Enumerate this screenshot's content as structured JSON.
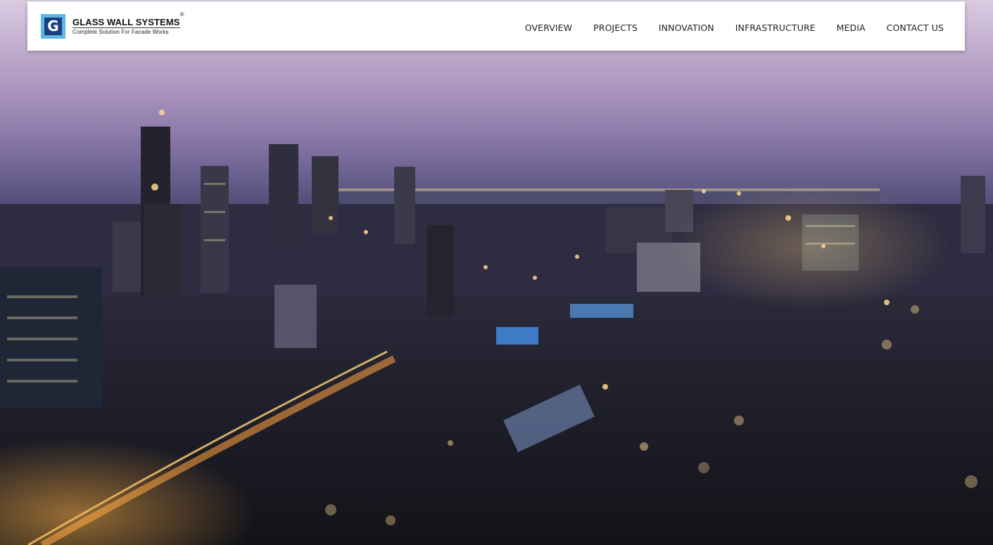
{
  "brand": {
    "mark_letter": "G",
    "name": "GLASS WALL SYSTEMS",
    "registered": "®",
    "tagline": "Complete Solution For Facade Works",
    "colors": {
      "mark_outer": "#5bb7e6",
      "mark_inner": "#1b3f7d"
    }
  },
  "nav": {
    "items": [
      {
        "label": "OVERVIEW"
      },
      {
        "label": "PROJECTS"
      },
      {
        "label": "INNOVATION"
      },
      {
        "label": "INFRASTRUCTURE"
      },
      {
        "label": "MEDIA"
      },
      {
        "label": "CONTACT US"
      }
    ]
  },
  "hero": {
    "image": "night-city-skyline-photo"
  }
}
